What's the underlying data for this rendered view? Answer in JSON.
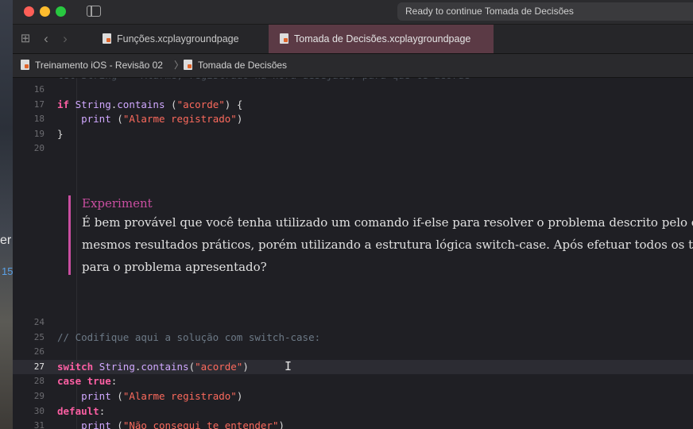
{
  "left_strip": {
    "frag_a": "er",
    "frag_b": "15"
  },
  "window": {
    "status_text": "Ready to continue Tomada de Decisões",
    "traffic_colors": {
      "close": "#ff5f57",
      "minimize": "#febc2e",
      "zoom": "#28c840"
    }
  },
  "tabs": [
    {
      "label": "Funções.xcplaygroundpage",
      "active": false
    },
    {
      "label": "Tomada de Decisões.xcplaygroundpage",
      "active": true
    }
  ],
  "breadcrumb": {
    "project": "Treinamento iOS - Revisão 02",
    "page": "Tomada de Decisões"
  },
  "code_top": [
    {
      "num": "16",
      "tokens": []
    },
    {
      "num": "17",
      "tokens": [
        {
          "t": "if",
          "c": "kw"
        },
        {
          "t": " ",
          "c": "pl"
        },
        {
          "t": "String",
          "c": "ty"
        },
        {
          "t": ".",
          "c": "pl"
        },
        {
          "t": "contains",
          "c": "fn"
        },
        {
          "t": " (",
          "c": "pl"
        },
        {
          "t": "\"acorde\"",
          "c": "str"
        },
        {
          "t": ") {",
          "c": "pl"
        }
      ]
    },
    {
      "num": "18",
      "tokens": [
        {
          "t": "    ",
          "c": "pl"
        },
        {
          "t": "print",
          "c": "fn"
        },
        {
          "t": " (",
          "c": "pl"
        },
        {
          "t": "\"Alarme registrado\"",
          "c": "str"
        },
        {
          "t": ")",
          "c": "pl"
        }
      ]
    },
    {
      "num": "19",
      "tokens": [
        {
          "t": "}",
          "c": "pl"
        }
      ]
    },
    {
      "num": "20",
      "tokens": []
    }
  ],
  "experiment": {
    "title": "Experiment",
    "lines": [
      "É bem provável que você tenha utilizado um comando if-else para resolver o problema descrito pelo exercí",
      "mesmos resultados práticos, porém utilizando a estrutura lógica switch-case. Após efetuar todos os testes",
      "para o problema apresentado?"
    ]
  },
  "code_bottom": [
    {
      "num": "24",
      "tokens": []
    },
    {
      "num": "25",
      "tokens": [
        {
          "t": "// Codifique aqui a solução com switch-case:",
          "c": "cm"
        }
      ]
    },
    {
      "num": "26",
      "tokens": []
    },
    {
      "num": "27",
      "tokens": [
        {
          "t": "switch",
          "c": "kw"
        },
        {
          "t": " ",
          "c": "pl"
        },
        {
          "t": "String",
          "c": "ty"
        },
        {
          "t": ".",
          "c": "pl"
        },
        {
          "t": "contains",
          "c": "fn"
        },
        {
          "t": "(",
          "c": "pl"
        },
        {
          "t": "\"acorde\"",
          "c": "str"
        },
        {
          "t": ")",
          "c": "pl"
        }
      ],
      "current": true
    },
    {
      "num": "28",
      "tokens": [
        {
          "t": "case",
          "c": "kw"
        },
        {
          "t": " ",
          "c": "pl"
        },
        {
          "t": "true",
          "c": "kw"
        },
        {
          "t": ":",
          "c": "pl"
        }
      ]
    },
    {
      "num": "29",
      "tokens": [
        {
          "t": "    ",
          "c": "pl"
        },
        {
          "t": "print",
          "c": "fn"
        },
        {
          "t": " (",
          "c": "pl"
        },
        {
          "t": "\"Alarme registrado\"",
          "c": "str"
        },
        {
          "t": ")",
          "c": "pl"
        }
      ]
    },
    {
      "num": "30",
      "tokens": [
        {
          "t": "default",
          "c": "kw"
        },
        {
          "t": ":",
          "c": "pl"
        }
      ]
    },
    {
      "num": "31",
      "tokens": [
        {
          "t": "    ",
          "c": "pl"
        },
        {
          "t": "print",
          "c": "fn"
        },
        {
          "t": " (",
          "c": "pl"
        },
        {
          "t": "\"Não consegui te entender\"",
          "c": "str"
        },
        {
          "t": ")",
          "c": "pl"
        }
      ]
    }
  ]
}
